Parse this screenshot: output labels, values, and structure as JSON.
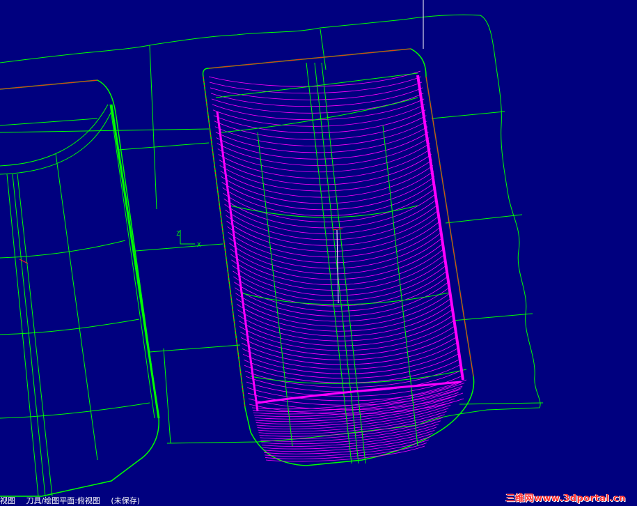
{
  "status_bar": {
    "view_label": "视图",
    "plane_label": "刀具/绘图平面:俯视图",
    "save_state": "(未保存)"
  },
  "axis": {
    "z_label": "Z",
    "x_label": "X"
  },
  "watermark": "三维网www.3dportal.cn",
  "colors": {
    "background": "#00007f",
    "wireframe": "#00ff00",
    "toolpath": "#ff00ff",
    "boundary": "#ff2020"
  }
}
